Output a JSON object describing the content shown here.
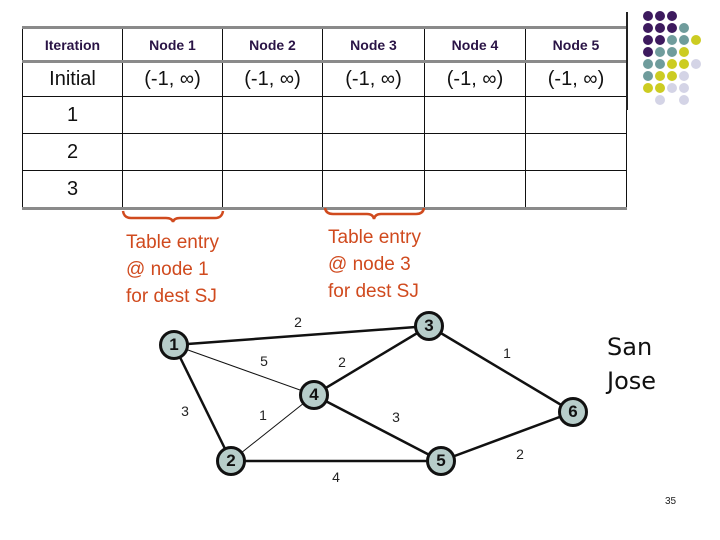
{
  "table": {
    "headers": [
      "Iteration",
      "Node 1",
      "Node 2",
      "Node 3",
      "Node 4",
      "Node 5"
    ],
    "rows": [
      [
        "Initial",
        "(-1, ∞)",
        "(-1, ∞)",
        "(-1, ∞)",
        "(-1, ∞)",
        "(-1, ∞)"
      ],
      [
        "1",
        "",
        "",
        "",
        "",
        ""
      ],
      [
        "2",
        "",
        "",
        "",
        "",
        ""
      ],
      [
        "3",
        "",
        "",
        "",
        "",
        ""
      ]
    ]
  },
  "annotations": [
    {
      "lines": [
        "Table entry",
        "@ node 1",
        "for dest SJ"
      ],
      "brace_under": "Node 1"
    },
    {
      "lines": [
        "Table entry",
        "@ node 3",
        "for dest SJ"
      ],
      "brace_under": "Node 3"
    }
  ],
  "graph": {
    "nodes": [
      "1",
      "2",
      "3",
      "4",
      "5",
      "6"
    ],
    "edges": [
      {
        "from": "1",
        "to": "3",
        "weight": "2"
      },
      {
        "from": "1",
        "to": "4",
        "weight": "5"
      },
      {
        "from": "1",
        "to": "2",
        "weight": "3"
      },
      {
        "from": "2",
        "to": "4",
        "weight": "1"
      },
      {
        "from": "2",
        "to": "5",
        "weight": "4"
      },
      {
        "from": "3",
        "to": "4",
        "weight": "2"
      },
      {
        "from": "4",
        "to": "5",
        "weight": "3"
      },
      {
        "from": "3",
        "to": "6",
        "weight": "1"
      },
      {
        "from": "5",
        "to": "6",
        "weight": "2"
      }
    ],
    "destination_label": [
      "San",
      "Jose"
    ]
  },
  "colors": {
    "annotation": "#d04a1e",
    "header_text": "#2a1446",
    "node_fill": "#b7cdca",
    "dot_palette": {
      "purple": "#3d1a5e",
      "teal": "#6f9c9c",
      "yellow": "#cccc22",
      "lavender": "#d4d4e6"
    }
  },
  "decoration": {
    "dot_grid": [
      [
        "purple",
        "purple",
        "purple",
        "",
        ""
      ],
      [
        "purple",
        "purple",
        "purple",
        "teal",
        ""
      ],
      [
        "purple",
        "purple",
        "teal",
        "teal",
        "yellow"
      ],
      [
        "purple",
        "teal",
        "teal",
        "yellow",
        ""
      ],
      [
        "teal",
        "teal",
        "yellow",
        "yellow",
        "lavender"
      ],
      [
        "teal",
        "yellow",
        "yellow",
        "lavender",
        ""
      ],
      [
        "yellow",
        "yellow",
        "lavender",
        "lavender",
        ""
      ],
      [
        "",
        "lavender",
        "",
        "lavender",
        ""
      ]
    ]
  },
  "page_number": "35"
}
